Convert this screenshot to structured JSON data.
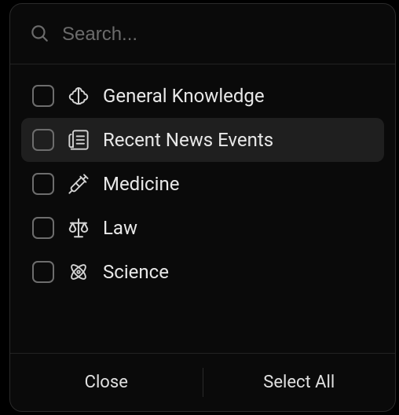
{
  "search": {
    "placeholder": "Search..."
  },
  "items": [
    {
      "id": "general-knowledge",
      "label": "General Knowledge",
      "icon": "brain"
    },
    {
      "id": "recent-news-events",
      "label": "Recent News Events",
      "icon": "newspaper"
    },
    {
      "id": "medicine",
      "label": "Medicine",
      "icon": "syringe"
    },
    {
      "id": "law",
      "label": "Law",
      "icon": "scales"
    },
    {
      "id": "science",
      "label": "Science",
      "icon": "atom"
    }
  ],
  "highlightedIndex": 1,
  "footer": {
    "close": "Close",
    "selectAll": "Select All"
  },
  "colors": {
    "stroke": "#d4d4d4"
  }
}
